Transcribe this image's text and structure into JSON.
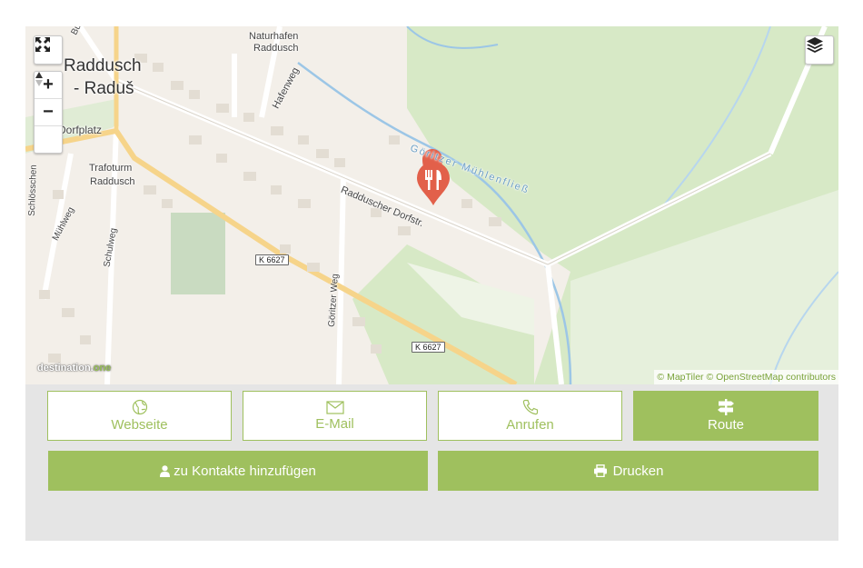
{
  "map": {
    "labels": {
      "village": "Raddusch",
      "village2": "- Raduš",
      "naturhafen1": "Naturhafen",
      "naturhafen2": "Raddusch",
      "dorfplatz": "Dorfplatz",
      "trafoturm1": "Trafoturm",
      "trafoturm2": "Raddusch",
      "hafenweg": "Hafenweg",
      "dorfstr": "Radduscher Dorfstr.",
      "muehlenfliess": "Göritzer Mühlenfließ",
      "schloesschen": "Schlösschen",
      "muehlweg": "Mühlweg",
      "schulweg": "Schulweg",
      "goritzerweg": "Göritzer Weg",
      "k6627_a": "K 6627",
      "k6627_b": "K 6627",
      "bu": "Bu"
    },
    "logo_left": "destination.",
    "logo_right": "one",
    "attribution": "© MapTiler © OpenStreetMap contributors",
    "controls": {
      "fullscreen_icon": "fullscreen-icon",
      "zoom_in": "+",
      "zoom_out": "−",
      "layers_icon": "layers-icon",
      "compass_icon": "compass-icon"
    },
    "marker_icon": "restaurant-marker-icon"
  },
  "actions": {
    "website": "Webseite",
    "email": "E-Mail",
    "call": "Anrufen",
    "route": "Route",
    "add_contact": "zu Kontakte hinzufügen",
    "print": "Drucken"
  },
  "colors": {
    "accent": "#9fc05e",
    "panel": "#e5e5e5",
    "map_land": "#f3efe9",
    "forest": "#d7e9c6",
    "water": "#9cc6e6",
    "main_road": "#f6d48a",
    "marker": "#e2604a"
  }
}
